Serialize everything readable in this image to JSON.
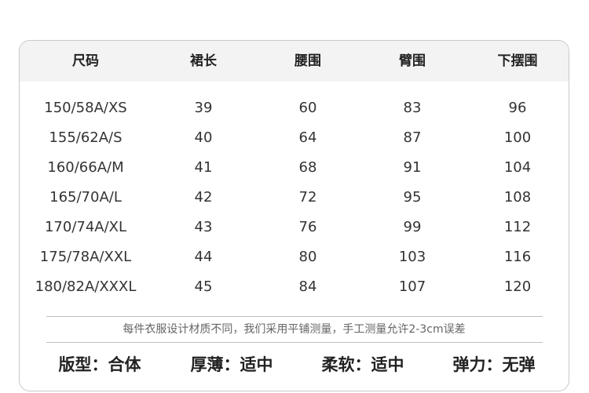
{
  "table": {
    "headers": [
      "尺码",
      "裙长",
      "腰围",
      "臂围",
      "下摆围"
    ],
    "rows": [
      [
        "150/58A/XS",
        "39",
        "60",
        "83",
        "96"
      ],
      [
        "155/62A/S",
        "40",
        "64",
        "87",
        "100"
      ],
      [
        "160/66A/M",
        "41",
        "68",
        "91",
        "104"
      ],
      [
        "165/70A/L",
        "42",
        "72",
        "95",
        "108"
      ],
      [
        "170/74A/XL",
        "43",
        "76",
        "99",
        "112"
      ],
      [
        "175/78A/XXL",
        "44",
        "80",
        "103",
        "116"
      ],
      [
        "180/82A/XXXL",
        "45",
        "84",
        "107",
        "120"
      ]
    ]
  },
  "note": "每件衣服设计材质不同，我们采用平铺测量，手工测量允许2-3cm误差",
  "properties": [
    "版型：合体",
    "厚薄：适中",
    "柔软：适中",
    "弹力：无弹"
  ]
}
